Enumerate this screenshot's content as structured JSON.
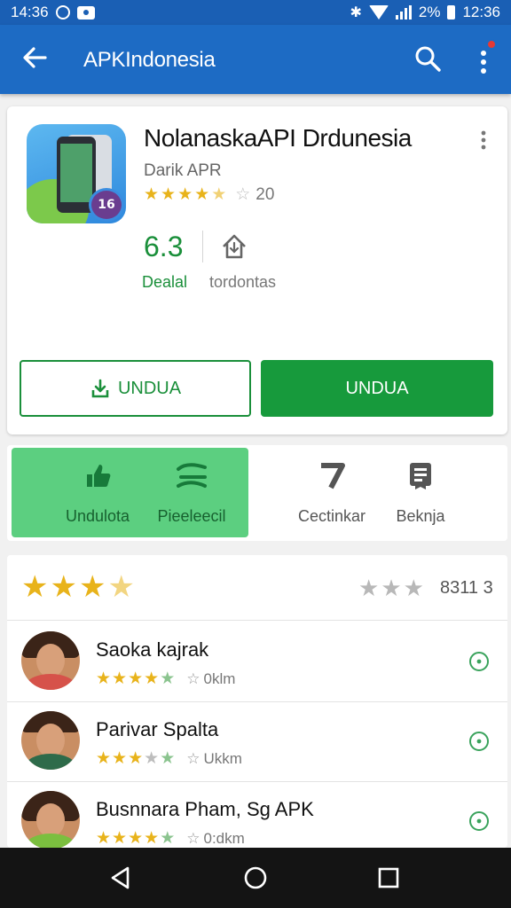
{
  "status_bar": {
    "time_left": "14:36",
    "battery": "2%",
    "time_right": "12:36",
    "icons": [
      "circle-icon",
      "message-icon",
      "bluetooth-icon",
      "wifi-icon",
      "signal-icon",
      "battery-icon"
    ]
  },
  "app_bar": {
    "title": "APKIndonesia",
    "icons": [
      "back-arrow-icon",
      "search-icon",
      "more-vertical-icon"
    ],
    "accent": "#1d6bc4"
  },
  "app": {
    "name": "NolanaskaAPI Drdunesia",
    "developer": "Darik APR",
    "rating_count": "20",
    "stat_value": "6.3",
    "stat_label": "Dealal",
    "install_label": "tordontas",
    "icon_badge": "16"
  },
  "buttons": {
    "outline_label": "UNDUA",
    "filled_label": "UNDUA",
    "accent": "#179a3c"
  },
  "actions": [
    {
      "label": "Undulota",
      "icon": "thumb-up-icon"
    },
    {
      "label": "Pieeleecil",
      "icon": "layers-icon"
    },
    {
      "label": "Cectinkar",
      "icon": "seven-icon"
    },
    {
      "label": "Beknja",
      "icon": "bookmark-list-icon"
    }
  ],
  "reviews_summary": {
    "count": "8311 3"
  },
  "reviews": [
    {
      "name": "Saoka kajrak",
      "meta": "0klm"
    },
    {
      "name": "Parivar Spalta",
      "meta": "Ukkm"
    },
    {
      "name": "Busnnara Pham, Sg APK",
      "meta": "0:dkm"
    }
  ],
  "nav_bar": {
    "icons": [
      "nav-back-icon",
      "nav-home-icon",
      "nav-recents-icon"
    ]
  }
}
